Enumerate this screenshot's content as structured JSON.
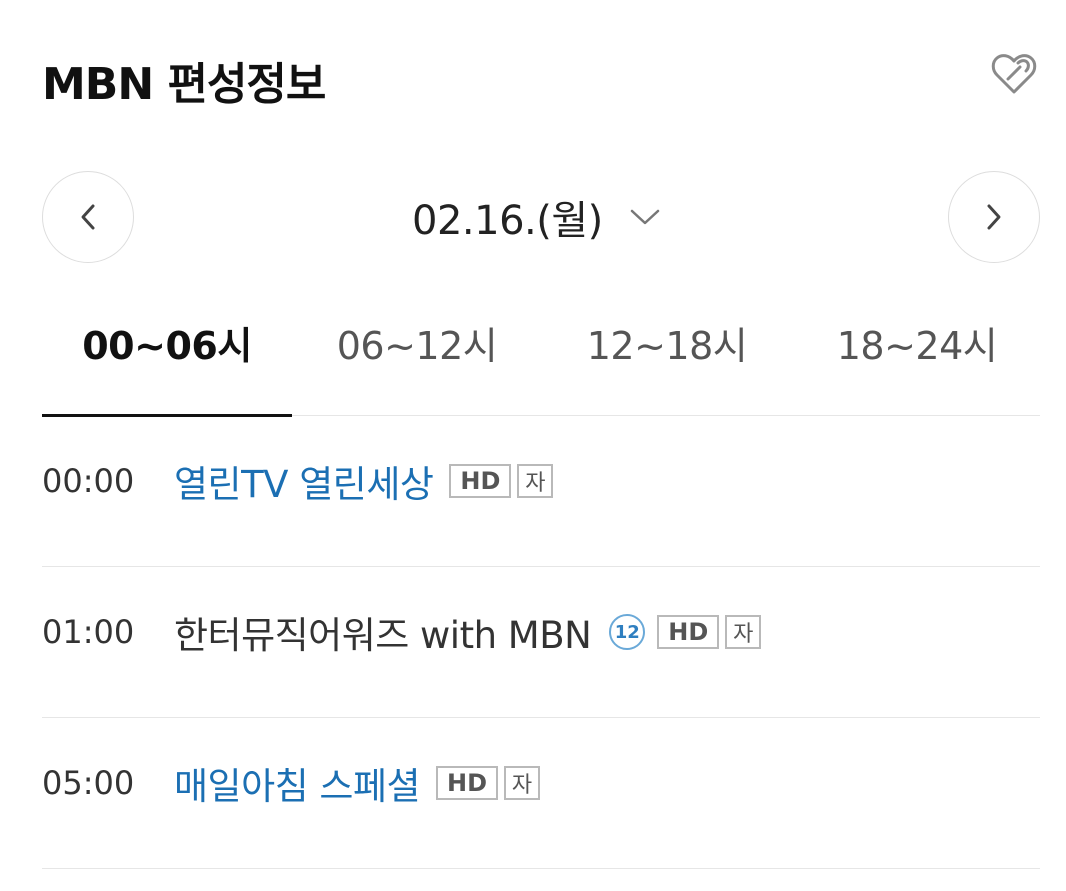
{
  "header": {
    "title": "MBN 편성정보",
    "favorite_icon": "heart-link-icon"
  },
  "date_nav": {
    "date": "02.16.(월)",
    "prev_icon": "chevron-left-icon",
    "next_icon": "chevron-right-icon",
    "dropdown_icon": "chevron-down-icon"
  },
  "tabs": [
    {
      "label": "00~06시",
      "active": true
    },
    {
      "label": "06~12시",
      "active": false
    },
    {
      "label": "12~18시",
      "active": false
    },
    {
      "label": "18~24시",
      "active": false
    }
  ],
  "schedule": [
    {
      "time": "00:00",
      "title": "열린TV 열린세상",
      "link": true,
      "badges": {
        "hd": "HD",
        "sub": "자"
      }
    },
    {
      "time": "01:00",
      "title": "한터뮤직어워즈 with MBN",
      "link": false,
      "badges": {
        "age": "12",
        "hd": "HD",
        "sub": "자"
      }
    },
    {
      "time": "05:00",
      "title": "매일아침 스페셜",
      "link": true,
      "badges": {
        "hd": "HD",
        "sub": "자"
      }
    }
  ],
  "colors": {
    "link": "#1b6fb3",
    "age_badge": "#2f7fc0",
    "active_tab_underline": "#111111"
  }
}
